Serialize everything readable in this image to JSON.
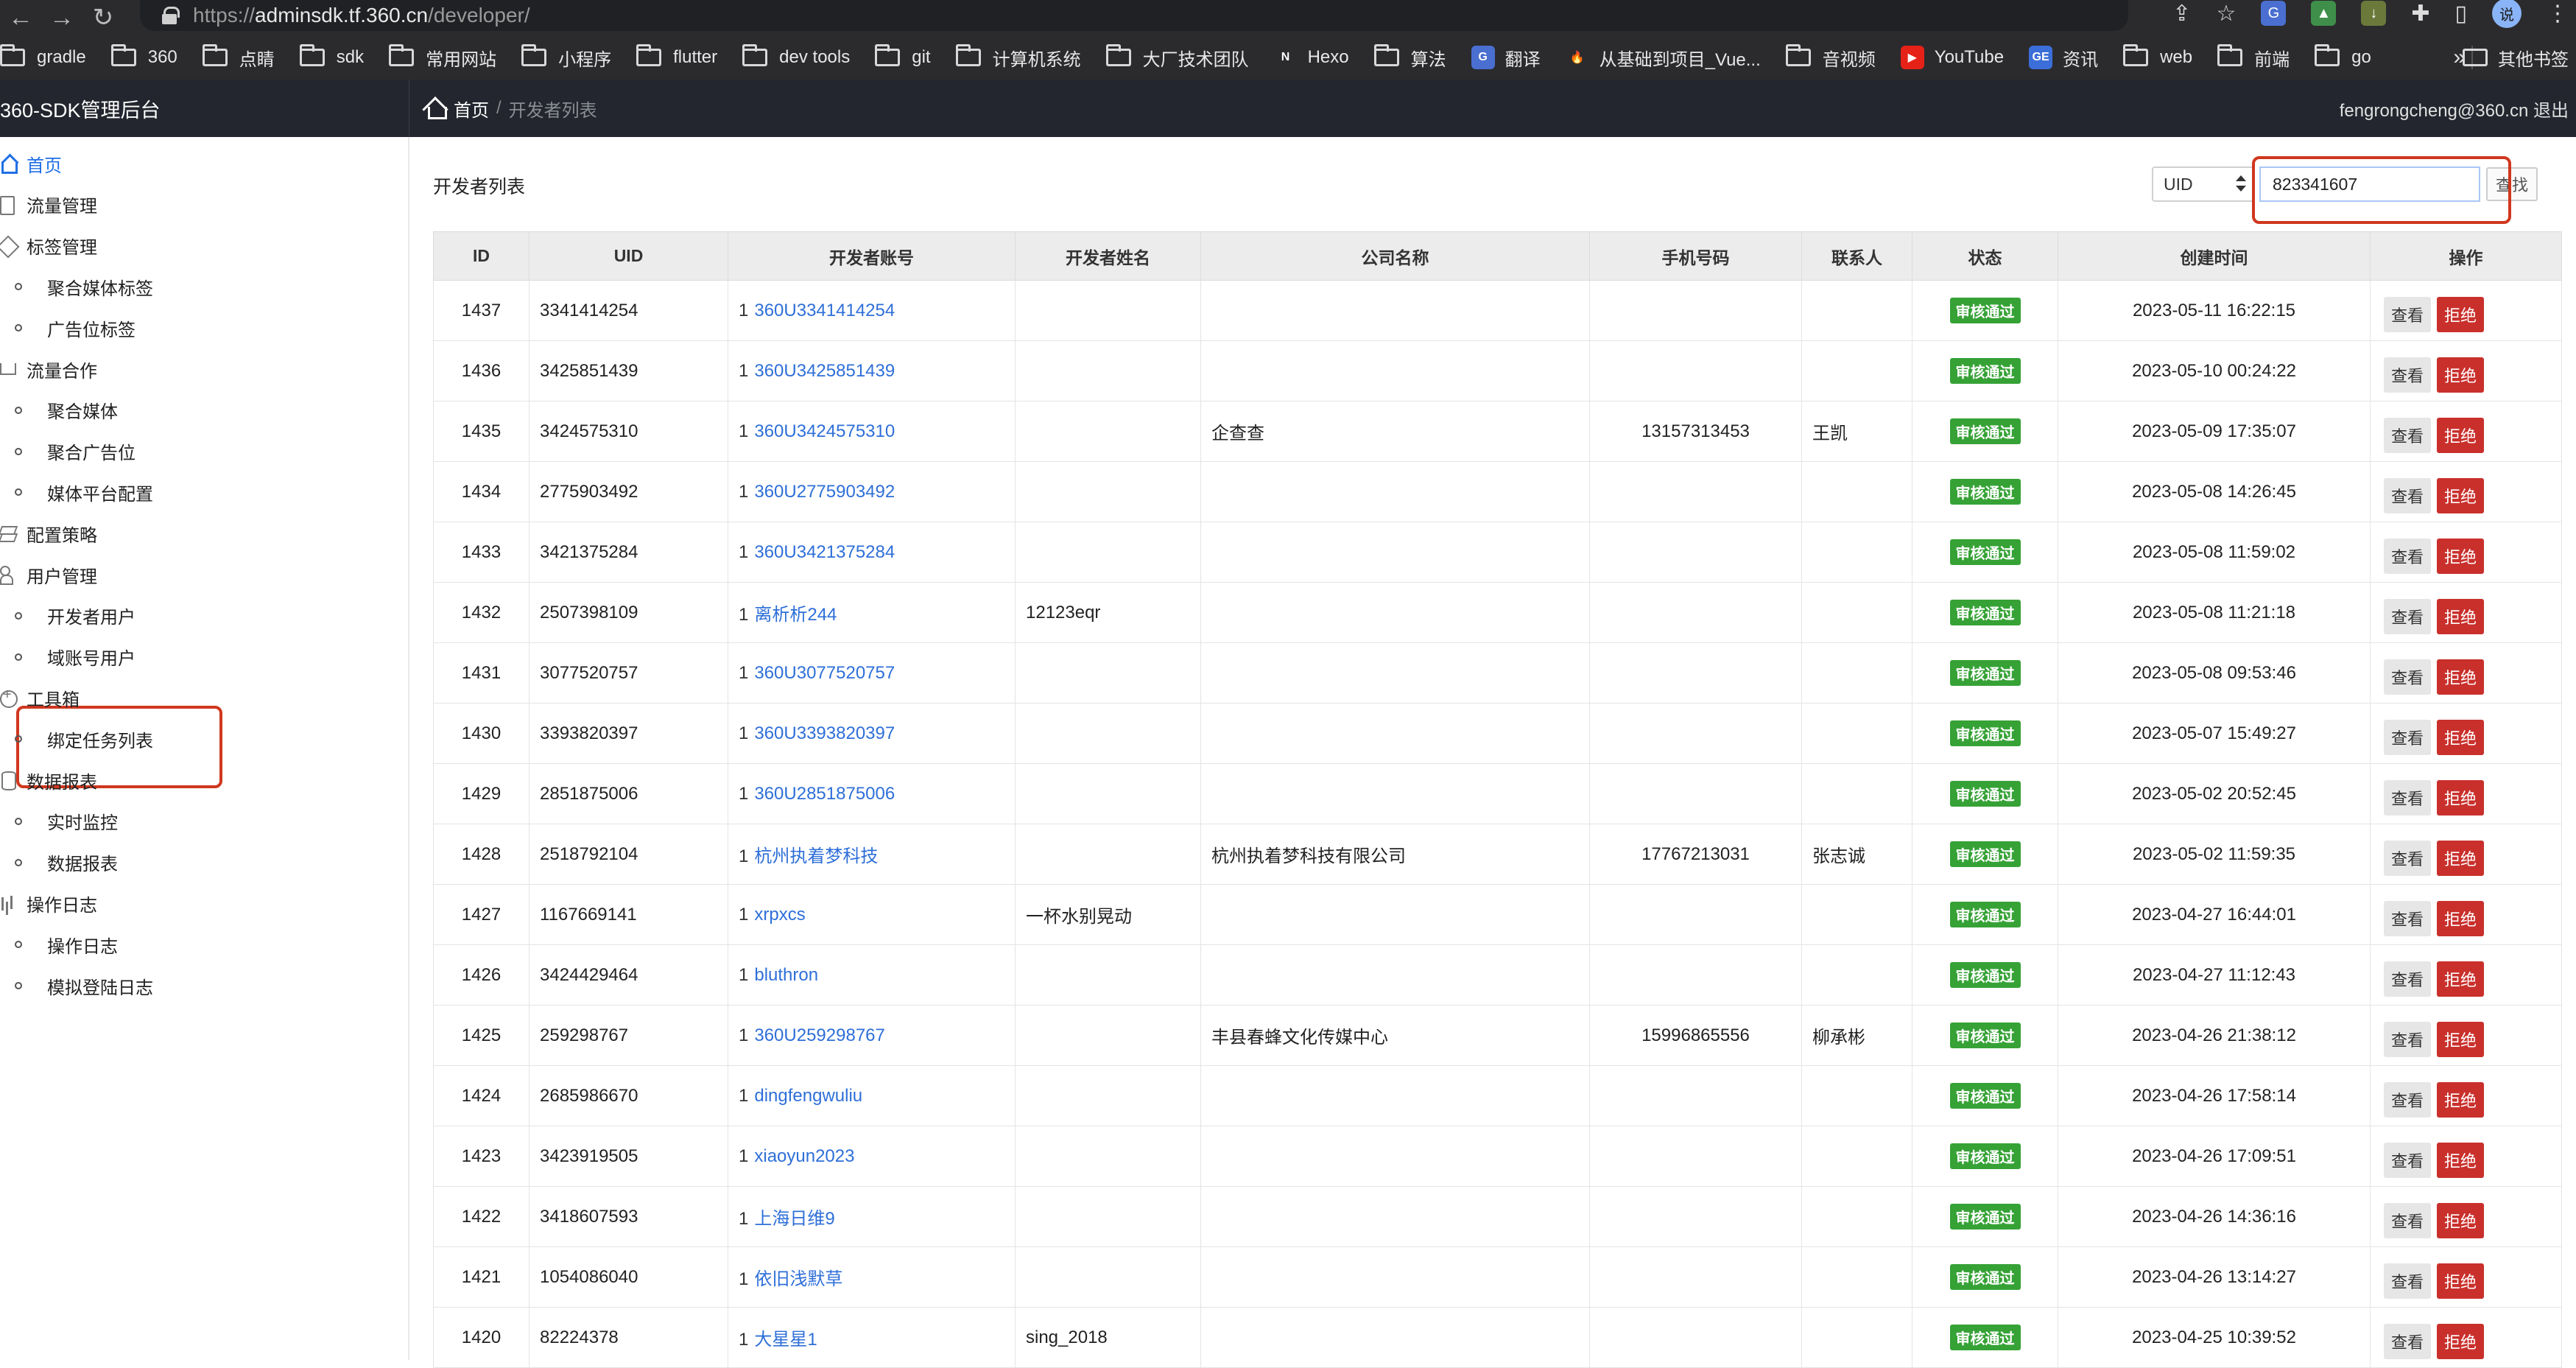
{
  "browser": {
    "url_scheme": "https://",
    "url_host": "adminsdk.tf.360.cn",
    "url_path": "/developer/",
    "avatar_letter": "说",
    "bookmarks": [
      {
        "label": "gradle",
        "icon": "folder-icon"
      },
      {
        "label": "360",
        "icon": "folder-icon"
      },
      {
        "label": "点睛",
        "icon": "folder-icon"
      },
      {
        "label": "sdk",
        "icon": "folder-icon"
      },
      {
        "label": "常用网站",
        "icon": "folder-icon"
      },
      {
        "label": "小程序",
        "icon": "folder-icon"
      },
      {
        "label": "flutter",
        "icon": "folder-icon"
      },
      {
        "label": "dev tools",
        "icon": "folder-icon"
      },
      {
        "label": "git",
        "icon": "folder-icon"
      },
      {
        "label": "计算机系统",
        "icon": "folder-icon"
      },
      {
        "label": "大厂技术团队",
        "icon": "folder-icon"
      },
      {
        "label": "Hexo",
        "icon": "hexo-icon"
      },
      {
        "label": "算法",
        "icon": "folder-icon"
      },
      {
        "label": "翻译",
        "icon": "translate-icon"
      },
      {
        "label": "从基础到项目_Vue...",
        "icon": "fire-icon"
      },
      {
        "label": "音视频",
        "icon": "folder-icon"
      },
      {
        "label": "YouTube",
        "icon": "youtube-icon"
      },
      {
        "label": "资讯",
        "icon": "news-icon"
      },
      {
        "label": "web",
        "icon": "folder-icon"
      },
      {
        "label": "前端",
        "icon": "folder-icon"
      },
      {
        "label": "go",
        "icon": "folder-icon"
      }
    ],
    "more_label": "»",
    "other_bookmarks": "其他书签"
  },
  "header": {
    "brand": "360-SDK管理后台",
    "breadcrumb_home": "首页",
    "breadcrumb_sep": "/",
    "breadcrumb_current": "开发者列表",
    "user": "fengrongcheng@360.cn 退出"
  },
  "sidebar": {
    "items": [
      {
        "label": "首页",
        "type": "top",
        "icon": "home-icon",
        "active": true
      },
      {
        "label": "流量管理",
        "type": "top",
        "icon": "doc-icon"
      },
      {
        "label": "标签管理",
        "type": "top",
        "icon": "tag-icon"
      },
      {
        "label": "聚合媒体标签",
        "type": "sub"
      },
      {
        "label": "广告位标签",
        "type": "sub"
      },
      {
        "label": "流量合作",
        "type": "top",
        "icon": "cart-icon"
      },
      {
        "label": "聚合媒体",
        "type": "sub"
      },
      {
        "label": "聚合广告位",
        "type": "sub"
      },
      {
        "label": "媒体平台配置",
        "type": "sub"
      },
      {
        "label": "配置策略",
        "type": "top",
        "icon": "stack-icon"
      },
      {
        "label": "用户管理",
        "type": "top",
        "icon": "users-icon"
      },
      {
        "label": "开发者用户",
        "type": "sub"
      },
      {
        "label": "域账号用户",
        "type": "sub"
      },
      {
        "label": "工具箱",
        "type": "top",
        "icon": "plus-circle-icon"
      },
      {
        "label": "绑定任务列表",
        "type": "sub"
      },
      {
        "label": "数据报表",
        "type": "top",
        "icon": "database-icon"
      },
      {
        "label": "实时监控",
        "type": "sub"
      },
      {
        "label": "数据报表",
        "type": "sub"
      },
      {
        "label": "操作日志",
        "type": "top",
        "icon": "bar-chart-icon"
      },
      {
        "label": "操作日志",
        "type": "sub"
      },
      {
        "label": "模拟登陆日志",
        "type": "sub"
      }
    ]
  },
  "main": {
    "title": "开发者列表",
    "search": {
      "select_value": "UID",
      "input_value": "823341607",
      "button_label": "查找"
    },
    "columns": [
      "ID",
      "UID",
      "开发者账号",
      "开发者姓名",
      "公司名称",
      "手机号码",
      "联系人",
      "状态",
      "创建时间",
      "操作"
    ],
    "account_prefix": "1",
    "status_label": "审核通过",
    "view_label": "查看",
    "reject_label": "拒绝",
    "rows": [
      {
        "id": "1437",
        "uid": "3341414254",
        "account": "360U3341414254",
        "name": "",
        "company": "",
        "phone": "",
        "contact": "",
        "created": "2023-05-11 16:22:15"
      },
      {
        "id": "1436",
        "uid": "3425851439",
        "account": "360U3425851439",
        "name": "",
        "company": "",
        "phone": "",
        "contact": "",
        "created": "2023-05-10 00:24:22"
      },
      {
        "id": "1435",
        "uid": "3424575310",
        "account": "360U3424575310",
        "name": "",
        "company": "企查查",
        "phone": "13157313453",
        "contact": "王凯",
        "created": "2023-05-09 17:35:07"
      },
      {
        "id": "1434",
        "uid": "2775903492",
        "account": "360U2775903492",
        "name": "",
        "company": "",
        "phone": "",
        "contact": "",
        "created": "2023-05-08 14:26:45"
      },
      {
        "id": "1433",
        "uid": "3421375284",
        "account": "360U3421375284",
        "name": "",
        "company": "",
        "phone": "",
        "contact": "",
        "created": "2023-05-08 11:59:02"
      },
      {
        "id": "1432",
        "uid": "2507398109",
        "account": "离析析244",
        "name": "12123eqr",
        "company": "",
        "phone": "",
        "contact": "",
        "created": "2023-05-08 11:21:18"
      },
      {
        "id": "1431",
        "uid": "3077520757",
        "account": "360U3077520757",
        "name": "",
        "company": "",
        "phone": "",
        "contact": "",
        "created": "2023-05-08 09:53:46"
      },
      {
        "id": "1430",
        "uid": "3393820397",
        "account": "360U3393820397",
        "name": "",
        "company": "",
        "phone": "",
        "contact": "",
        "created": "2023-05-07 15:49:27"
      },
      {
        "id": "1429",
        "uid": "2851875006",
        "account": "360U2851875006",
        "name": "",
        "company": "",
        "phone": "",
        "contact": "",
        "created": "2023-05-02 20:52:45"
      },
      {
        "id": "1428",
        "uid": "2518792104",
        "account": "杭州执着梦科技",
        "name": "",
        "company": "杭州执着梦科技有限公司",
        "phone": "17767213031",
        "contact": "张志诚",
        "created": "2023-05-02 11:59:35"
      },
      {
        "id": "1427",
        "uid": "1167669141",
        "account": "xrpxcs",
        "name": "一杯水别晃动",
        "company": "",
        "phone": "",
        "contact": "",
        "created": "2023-04-27 16:44:01"
      },
      {
        "id": "1426",
        "uid": "3424429464",
        "account": "bluthron",
        "name": "",
        "company": "",
        "phone": "",
        "contact": "",
        "created": "2023-04-27 11:12:43"
      },
      {
        "id": "1425",
        "uid": "259298767",
        "account": "360U259298767",
        "name": "",
        "company": "丰县春蜂文化传媒中心",
        "phone": "15996865556",
        "contact": "柳承彬",
        "created": "2023-04-26 21:38:12"
      },
      {
        "id": "1424",
        "uid": "2685986670",
        "account": "dingfengwuliu",
        "name": "",
        "company": "",
        "phone": "",
        "contact": "",
        "created": "2023-04-26 17:58:14"
      },
      {
        "id": "1423",
        "uid": "3423919505",
        "account": "xiaoyun2023",
        "name": "",
        "company": "",
        "phone": "",
        "contact": "",
        "created": "2023-04-26 17:09:51"
      },
      {
        "id": "1422",
        "uid": "3418607593",
        "account": "上海日维9",
        "name": "",
        "company": "",
        "phone": "",
        "contact": "",
        "created": "2023-04-26 14:36:16"
      },
      {
        "id": "1421",
        "uid": "1054086040",
        "account": "依旧浅默草",
        "name": "",
        "company": "",
        "phone": "",
        "contact": "",
        "created": "2023-04-26 13:14:27"
      },
      {
        "id": "1420",
        "uid": "82224378",
        "account": "大星星1",
        "name": "sing_2018",
        "company": "",
        "phone": "",
        "contact": "",
        "created": "2023-04-25 10:39:52"
      }
    ]
  },
  "colors": {
    "status_green": "#36a236",
    "reject_red": "#c9302c",
    "link_blue": "#2e6fd8",
    "highlight_red": "#d0371f",
    "header_dark": "#23262e"
  }
}
